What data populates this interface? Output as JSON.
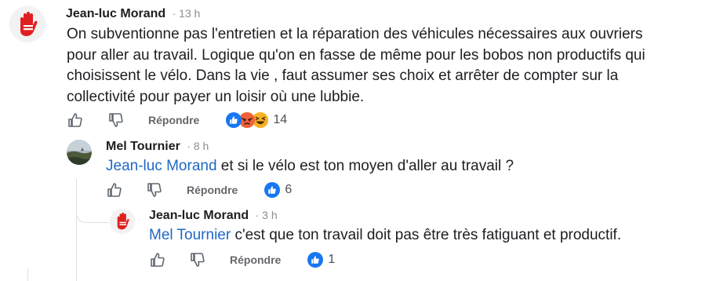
{
  "comments": [
    {
      "author": "Jean-luc Morand",
      "time": "13 h",
      "lines": [
        "On subventionne pas l'entretien et la réparation des véhicules nécessaires aux ouvriers",
        "pour aller au travail. Logique qu'on en fasse de même pour les bobos non productifs qui",
        "choisissent le vélo. Dans la vie , faut assumer ses choix et arrêter de compter sur la",
        "collectivité pour payer un loisir où une lubbie."
      ],
      "reply_label": "Répondre",
      "reaction_count": "14",
      "reactions": [
        "like-icon",
        "angry-icon",
        "haha-icon"
      ]
    },
    {
      "author": "Mel Tournier",
      "time": "8 h",
      "mention": "Jean-luc Morand",
      "text": " et si le vélo est ton moyen d'aller au travail ?",
      "reply_label": "Répondre",
      "reaction_count": "6",
      "reactions": [
        "like-icon"
      ]
    },
    {
      "author": "Jean-luc Morand",
      "time": "3 h",
      "mention": "Mel Tournier",
      "text": " c'est que ton travail doit pas être très fatiguant et productif.",
      "reply_label": "Répondre",
      "reaction_count": "1",
      "reactions": [
        "like-icon"
      ]
    }
  ],
  "separator": "·",
  "colors": {
    "mention": "#1f68c4",
    "like": "#1877f2",
    "meta": "#8a8d91",
    "avatar_red": "#e02020"
  }
}
